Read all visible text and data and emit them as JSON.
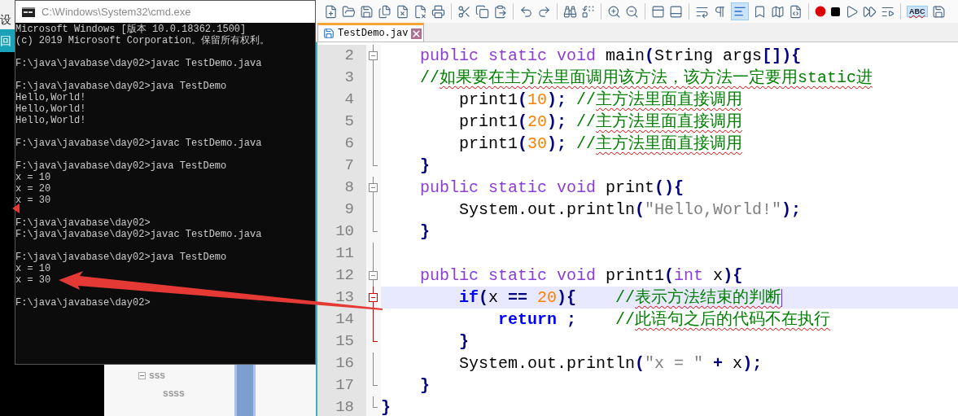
{
  "background": {
    "side_text": "设",
    "side_button": "回",
    "tree": [
      {
        "label": "sss",
        "expanded": true,
        "children": [
          {
            "label": "ssss"
          }
        ]
      }
    ]
  },
  "console": {
    "title": "C:\\Windows\\System32\\cmd.exe",
    "blocks": [
      [
        "Microsoft Windows [版本 10.0.18362.1500]",
        "(c) 2019 Microsoft Corporation。保留所有权利。"
      ],
      [
        "F:\\java\\javabase\\day02>javac TestDemo.java"
      ],
      [
        "F:\\java\\javabase\\day02>java TestDemo",
        "Hello,World!",
        "Hello,World!",
        "Hello,World!"
      ],
      [
        "F:\\java\\javabase\\day02>javac TestDemo.java"
      ],
      [
        "F:\\java\\javabase\\day02>java TestDemo",
        "x = 10",
        "x = 20",
        "x = 30"
      ],
      [
        "F:\\java\\javabase\\day02>",
        "F:\\java\\javabase\\day02>javac TestDemo.java"
      ],
      [
        "F:\\java\\javabase\\day02>java TestDemo",
        "x = 10",
        "x = 30"
      ],
      [
        "F:\\java\\javabase\\day02>"
      ]
    ]
  },
  "editor": {
    "toolbar": {
      "indent_guide_on": true,
      "spell_check": {
        "label": "ABC",
        "on": true
      }
    },
    "tabs": [
      {
        "label": "TestDemo.jav",
        "selected": true,
        "saved": true
      }
    ],
    "lines": [
      {
        "number": "2",
        "fold_start": true,
        "fold_end": false,
        "fold_highlight": false,
        "current": false,
        "tokens": [
          {
            "kind": "keyword",
            "text": "    public"
          },
          {
            "kind": "keyword",
            "text": " static"
          },
          {
            "kind": "keyword",
            "text": " void"
          },
          {
            "kind": "plain",
            "text": " main"
          },
          {
            "kind": "operator",
            "text": "("
          },
          {
            "kind": "plain",
            "text": "String args"
          },
          {
            "kind": "operator",
            "text": "[]){"
          }
        ]
      },
      {
        "number": "3",
        "fold_start": false,
        "fold_end": false,
        "fold_highlight": false,
        "current": false,
        "tokens": [
          {
            "kind": "comment",
            "text": "    //"
          },
          {
            "kind": "comment",
            "text": "如果要在主方法里面调用该方法，该方法一定要用static进",
            "spell_error": true
          }
        ]
      },
      {
        "number": "4",
        "fold_start": false,
        "fold_end": false,
        "fold_highlight": false,
        "current": false,
        "tokens": [
          {
            "kind": "plain",
            "text": "        print1"
          },
          {
            "kind": "operator",
            "text": "("
          },
          {
            "kind": "number",
            "text": "10"
          },
          {
            "kind": "operator",
            "text": ");"
          },
          {
            "kind": "comment",
            "text": " //"
          },
          {
            "kind": "comment",
            "text": "主方法里面直接调用",
            "spell_error": true
          }
        ]
      },
      {
        "number": "5",
        "fold_start": false,
        "fold_end": false,
        "fold_highlight": false,
        "current": false,
        "tokens": [
          {
            "kind": "plain",
            "text": "        print1"
          },
          {
            "kind": "operator",
            "text": "("
          },
          {
            "kind": "number",
            "text": "20"
          },
          {
            "kind": "operator",
            "text": ");"
          },
          {
            "kind": "comment",
            "text": " //"
          },
          {
            "kind": "comment",
            "text": "主方法里面直接调用",
            "spell_error": true
          }
        ]
      },
      {
        "number": "6",
        "fold_start": false,
        "fold_end": false,
        "fold_highlight": false,
        "current": false,
        "tokens": [
          {
            "kind": "plain",
            "text": "        print1"
          },
          {
            "kind": "operator",
            "text": "("
          },
          {
            "kind": "number",
            "text": "30"
          },
          {
            "kind": "operator",
            "text": ");"
          },
          {
            "kind": "comment",
            "text": " //"
          },
          {
            "kind": "comment",
            "text": "主方法里面直接调用",
            "spell_error": true
          }
        ]
      },
      {
        "number": "7",
        "fold_start": false,
        "fold_end": true,
        "fold_highlight": false,
        "current": false,
        "tokens": [
          {
            "kind": "operator",
            "text": "    }"
          }
        ]
      },
      {
        "number": "8",
        "fold_start": true,
        "fold_end": false,
        "fold_highlight": false,
        "current": false,
        "tokens": [
          {
            "kind": "keyword",
            "text": "    public"
          },
          {
            "kind": "keyword",
            "text": " static"
          },
          {
            "kind": "keyword",
            "text": " void"
          },
          {
            "kind": "plain",
            "text": " print"
          },
          {
            "kind": "operator",
            "text": "(){"
          }
        ]
      },
      {
        "number": "9",
        "fold_start": false,
        "fold_end": false,
        "fold_highlight": false,
        "current": false,
        "tokens": [
          {
            "kind": "plain",
            "text": "        System.out.println"
          },
          {
            "kind": "operator",
            "text": "("
          },
          {
            "kind": "string",
            "text": "\"Hello,World!\""
          },
          {
            "kind": "operator",
            "text": ");"
          }
        ]
      },
      {
        "number": "10",
        "fold_start": false,
        "fold_end": true,
        "fold_highlight": false,
        "current": false,
        "tokens": [
          {
            "kind": "operator",
            "text": "    }"
          }
        ]
      },
      {
        "number": "11",
        "fold_start": false,
        "fold_end": false,
        "fold_highlight": false,
        "current": false
      },
      {
        "number": "12",
        "fold_start": true,
        "fold_end": false,
        "fold_highlight": false,
        "current": false,
        "tokens": [
          {
            "kind": "keyword",
            "text": "    public"
          },
          {
            "kind": "keyword",
            "text": " static"
          },
          {
            "kind": "keyword",
            "text": " void"
          },
          {
            "kind": "plain",
            "text": " print1"
          },
          {
            "kind": "operator",
            "text": "("
          },
          {
            "kind": "keyword",
            "text": "int"
          },
          {
            "kind": "plain",
            "text": " x"
          },
          {
            "kind": "operator",
            "text": "){"
          }
        ]
      },
      {
        "number": "13",
        "fold_start": true,
        "fold_end": false,
        "fold_highlight": true,
        "current": true,
        "tokens": [
          {
            "kind": "control",
            "text": "        if"
          },
          {
            "kind": "operator",
            "text": "("
          },
          {
            "kind": "plain",
            "text": "x "
          },
          {
            "kind": "operator",
            "text": "=="
          },
          {
            "kind": "number",
            "text": " 20"
          },
          {
            "kind": "operator",
            "text": "){"
          },
          {
            "kind": "comment",
            "text": "    //"
          },
          {
            "kind": "comment",
            "text": "表示方法结束的判断",
            "spell_error": true
          }
        ]
      },
      {
        "number": "14",
        "fold_start": false,
        "fold_end": false,
        "fold_highlight": true,
        "current": false,
        "tokens": [
          {
            "kind": "control",
            "text": "            return"
          },
          {
            "kind": "operator",
            "text": " ;"
          },
          {
            "kind": "comment",
            "text": "    //"
          },
          {
            "kind": "comment",
            "text": "此语句之后的代码不在执行",
            "spell_error": true
          }
        ]
      },
      {
        "number": "15",
        "fold_start": false,
        "fold_end": true,
        "fold_highlight": true,
        "current": false,
        "tokens": [
          {
            "kind": "operator",
            "text": "        }"
          }
        ]
      },
      {
        "number": "16",
        "fold_start": false,
        "fold_end": false,
        "fold_highlight": false,
        "current": false,
        "tokens": [
          {
            "kind": "plain",
            "text": "        System.out.println"
          },
          {
            "kind": "operator",
            "text": "("
          },
          {
            "kind": "string",
            "text": "\"x = \""
          },
          {
            "kind": "operator",
            "text": " +"
          },
          {
            "kind": "plain",
            "text": " x"
          },
          {
            "kind": "operator",
            "text": ");"
          }
        ]
      },
      {
        "number": "17",
        "fold_start": false,
        "fold_end": true,
        "fold_highlight": false,
        "current": false,
        "tokens": [
          {
            "kind": "operator",
            "text": "    }"
          }
        ]
      },
      {
        "number": "18",
        "fold_start": false,
        "fold_end": true,
        "fold_highlight": false,
        "current": false,
        "tokens": [
          {
            "kind": "operator",
            "text": "}"
          }
        ]
      }
    ]
  }
}
